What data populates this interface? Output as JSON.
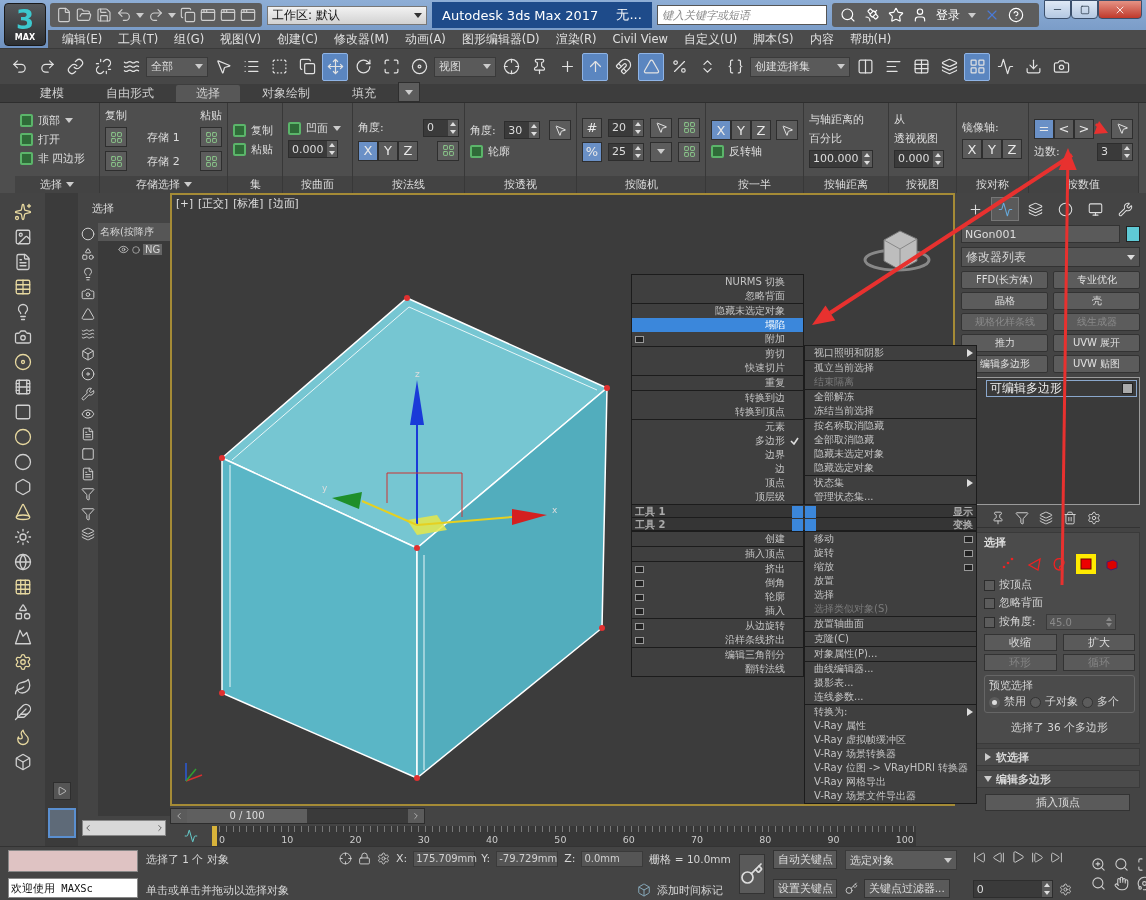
{
  "logo": {
    "digit": "3",
    "sub": "MAX"
  },
  "workspace": "工作区: 默认",
  "title": "Autodesk 3ds Max 2017",
  "file_title": "无...",
  "search": {
    "placeholder": "键入关键字或短语"
  },
  "login": "登录",
  "menu": [
    "编辑(E)",
    "工具(T)",
    "组(G)",
    "视图(V)",
    "创建(C)",
    "修改器(M)",
    "动画(A)",
    "图形编辑器(D)",
    "渲染(R)",
    "Civil View",
    "自定义(U)",
    "脚本(S)",
    "内容",
    "帮助(H)"
  ],
  "toolbar": [
    {
      "kind": "tool",
      "selected": false
    },
    {
      "kind": "tool",
      "selected": false
    },
    {
      "kind": "tool",
      "selected": false
    },
    {
      "kind": "tool",
      "selected": false
    },
    {
      "kind": "tool",
      "selected": false
    },
    {
      "kind": "dropdown",
      "value": "全部"
    },
    {
      "kind": "tool",
      "selected": false
    },
    {
      "kind": "tool",
      "selected": false
    },
    {
      "kind": "tool",
      "selected": false
    },
    {
      "kind": "tool",
      "selected": false
    },
    {
      "kind": "tool",
      "selected": true
    },
    {
      "kind": "tool",
      "selected": false
    },
    {
      "kind": "tool",
      "selected": false
    },
    {
      "kind": "tool",
      "selected": false
    },
    {
      "kind": "dropdown",
      "value": "视图"
    },
    {
      "kind": "tool",
      "selected": false
    },
    {
      "kind": "tool",
      "selected": false
    },
    {
      "kind": "tool",
      "selected": false
    },
    {
      "kind": "tool",
      "selected": true
    },
    {
      "kind": "tool",
      "selected": false
    },
    {
      "kind": "tool",
      "selected": true
    },
    {
      "kind": "tool",
      "selected": false
    },
    {
      "kind": "tool",
      "selected": false
    },
    {
      "kind": "tool",
      "selected": false
    },
    {
      "kind": "dropdown",
      "value": "创建选择集"
    },
    {
      "kind": "tool",
      "selected": false
    },
    {
      "kind": "tool",
      "selected": false
    },
    {
      "kind": "tool",
      "selected": false
    },
    {
      "kind": "tool",
      "selected": false
    },
    {
      "kind": "tool",
      "selected": true
    },
    {
      "kind": "tool",
      "selected": false
    },
    {
      "kind": "tool",
      "selected": false
    },
    {
      "kind": "tool",
      "selected": false
    }
  ],
  "ribbon_tabs": [
    {
      "label": "建模",
      "selected": false
    },
    {
      "label": "自由形式",
      "selected": false
    },
    {
      "label": "选择",
      "selected": true
    },
    {
      "label": "对象绘制",
      "selected": false
    },
    {
      "label": "填充",
      "selected": false
    }
  ],
  "ribbon_groups": [
    {
      "title": "选择",
      "menu": true,
      "rows": [
        [
          {
            "kind": "icon-label",
            "label": "顶部",
            "caret": true
          }
        ],
        [
          {
            "kind": "icon-label",
            "label": "打开",
            "caret": false
          }
        ],
        [
          {
            "kind": "icon-label",
            "label": "非 四边形",
            "caret": false
          }
        ]
      ]
    },
    {
      "title": "存储选择",
      "menu": true,
      "rows": [
        [
          {
            "kind": "label",
            "label": "复制"
          },
          {
            "kind": "label",
            "label": "粘贴"
          }
        ],
        [
          {
            "kind": "button"
          },
          {
            "kind": "label",
            "label": "存储 1"
          },
          {
            "kind": "button"
          }
        ],
        [
          {
            "kind": "button"
          },
          {
            "kind": "label",
            "label": "存储 2"
          },
          {
            "kind": "button"
          }
        ]
      ]
    },
    {
      "title": "集",
      "menu": false,
      "rows": [
        [
          {
            "kind": "icon-label",
            "label": "复制",
            "caret": false
          }
        ],
        [
          {
            "kind": "icon-label",
            "label": "粘贴",
            "caret": false
          }
        ]
      ]
    },
    {
      "title": "按曲面",
      "menu": false,
      "rows": [
        [
          {
            "kind": "icon-label",
            "label": "凹面",
            "caret": true
          }
        ],
        [
          {
            "kind": "spinner",
            "value": "0.000"
          }
        ]
      ]
    },
    {
      "title": "按法线",
      "menu": false,
      "rows": [
        [
          {
            "kind": "label",
            "label": "角度:"
          },
          {
            "kind": "spinner",
            "value": "0"
          }
        ],
        [
          {
            "kind": "axis",
            "axes": [
              {
                "label": "X",
                "selected": true
              },
              {
                "label": "Y",
                "selected": false
              },
              {
                "label": "Z",
                "selected": false
              }
            ]
          },
          {
            "kind": "button"
          }
        ]
      ]
    },
    {
      "title": "按透视",
      "menu": false,
      "rows": [
        [
          {
            "kind": "label",
            "label": "角度:"
          },
          {
            "kind": "spinner",
            "value": "30"
          },
          {
            "kind": "pointer"
          }
        ],
        [
          {
            "kind": "icon-label",
            "label": "轮廓",
            "caret": false
          }
        ]
      ]
    },
    {
      "title": "按随机",
      "menu": false,
      "rows": [
        [
          {
            "kind": "toggle",
            "label": "#",
            "selected": false
          },
          {
            "kind": "spinner",
            "value": "20"
          },
          {
            "kind": "pointer"
          },
          {
            "kind": "button"
          }
        ],
        [
          {
            "kind": "toggle",
            "label": "%",
            "selected": true
          },
          {
            "kind": "spinner",
            "value": "25"
          },
          {
            "kind": "caret-button"
          },
          {
            "kind": "button"
          }
        ]
      ]
    },
    {
      "title": "按一半",
      "menu": false,
      "rows": [
        [
          {
            "kind": "axis",
            "axes": [
              {
                "label": "X",
                "selected": true
              },
              {
                "label": "Y",
                "selected": false
              },
              {
                "label": "Z",
                "selected": false
              }
            ]
          },
          {
            "kind": "pointer"
          }
        ],
        [
          {
            "kind": "icon-label",
            "label": "反转轴",
            "caret": false
          }
        ]
      ]
    },
    {
      "title": "按轴距离",
      "menu": false,
      "rows": [
        [
          {
            "kind": "label",
            "label": "与轴距离的"
          }
        ],
        [
          {
            "kind": "label",
            "label": "百分比"
          }
        ],
        [
          {
            "kind": "spinner",
            "value": "100.000"
          }
        ]
      ]
    },
    {
      "title": "按视图",
      "menu": false,
      "rows": [
        [
          {
            "kind": "label",
            "label": "从"
          }
        ],
        [
          {
            "kind": "label",
            "label": "透视视图"
          }
        ],
        [
          {
            "kind": "spinner",
            "value": "0.000"
          }
        ]
      ]
    },
    {
      "title": "按对称",
      "menu": false,
      "rows": [
        [
          {
            "kind": "label",
            "label": "镜像轴:"
          }
        ],
        [
          {
            "kind": "axis",
            "axes": [
              {
                "label": "X",
                "selected": false
              },
              {
                "label": "Y",
                "selected": false
              },
              {
                "label": "Z",
                "selected": false
              }
            ]
          }
        ]
      ]
    },
    {
      "title": "按数值",
      "menu": false,
      "rows": [
        [
          {
            "kind": "axis",
            "axes": [
              {
                "label": "=",
                "selected": true
              },
              {
                "label": "<",
                "selected": false
              },
              {
                "label": ">",
                "selected": false
              }
            ]
          },
          {
            "kind": "pointer"
          }
        ],
        [
          {
            "kind": "label",
            "label": "边数:"
          },
          {
            "kind": "spinner",
            "value": "3"
          }
        ]
      ]
    }
  ],
  "explorer": {
    "title": "选择",
    "column": "名称(按降序",
    "row": "NG"
  },
  "viewport": {
    "labels": [
      "[+]",
      "[正交]",
      "[标准]",
      "[边面]"
    ],
    "gizmo_labels": [
      "z",
      "y",
      "x"
    ]
  },
  "quad": {
    "top_left": [
      [
        {
          "label": "NURMS 切换",
          "kind": "plain",
          "selected": false
        },
        {
          "label": "忽略背面",
          "kind": "plain",
          "selected": false
        }
      ],
      [
        {
          "label": "隐藏未选定对象",
          "kind": "plain",
          "selected": false
        },
        {
          "label": "塌陷",
          "kind": "plain",
          "selected": true
        },
        {
          "label": "附加",
          "kind": "box",
          "selected": false
        }
      ],
      [
        {
          "label": "剪切",
          "kind": "plain",
          "selected": false
        },
        {
          "label": "快速切片",
          "kind": "plain",
          "selected": false
        }
      ],
      [
        {
          "label": "重复",
          "kind": "plain",
          "selected": false
        }
      ],
      [
        {
          "label": "转换到边",
          "kind": "plain",
          "selected": false
        },
        {
          "label": "转换到顶点",
          "kind": "plain",
          "selected": false
        }
      ],
      [
        {
          "label": "元素",
          "kind": "plain",
          "selected": false,
          "checked": false
        },
        {
          "label": "多边形",
          "kind": "plain",
          "selected": false,
          "checked": true
        },
        {
          "label": "边界",
          "kind": "plain",
          "selected": false,
          "checked": false
        },
        {
          "label": "边",
          "kind": "plain",
          "selected": false,
          "checked": false
        },
        {
          "label": "顶点",
          "kind": "plain",
          "selected": false,
          "checked": false
        },
        {
          "label": "顶层级",
          "kind": "plain",
          "selected": false,
          "checked": false
        }
      ]
    ],
    "top_right": [
      [
        {
          "label": "视口照明和阴影",
          "kind": "submenu",
          "selected": false
        }
      ],
      [
        {
          "label": "孤立当前选择",
          "kind": "plain",
          "selected": false,
          "disabled": false
        },
        {
          "label": "结束隔离",
          "kind": "plain",
          "selected": false,
          "disabled": true
        }
      ],
      [
        {
          "label": "全部解冻",
          "kind": "plain",
          "selected": false
        },
        {
          "label": "冻结当前选择",
          "kind": "plain",
          "selected": false
        }
      ],
      [
        {
          "label": "按名称取消隐藏",
          "kind": "plain",
          "selected": false
        },
        {
          "label": "全部取消隐藏",
          "kind": "plain",
          "selected": false
        },
        {
          "label": "隐藏未选定对象",
          "kind": "plain",
          "selected": false
        },
        {
          "label": "隐藏选定对象",
          "kind": "plain",
          "selected": false
        }
      ],
      [
        {
          "label": "状态集",
          "kind": "submenu",
          "selected": false
        },
        {
          "label": "管理状态集...",
          "kind": "plain",
          "selected": false
        }
      ]
    ],
    "bars": [
      {
        "left": "工具 1",
        "right": "显示"
      },
      {
        "left": "工具 2",
        "right": "变换"
      }
    ],
    "bottom_left": [
      [
        {
          "label": "创建",
          "kind": "plain",
          "selected": false
        }
      ],
      [
        {
          "label": "插入顶点",
          "kind": "plain",
          "selected": false
        }
      ],
      [
        {
          "label": "挤出",
          "kind": "box",
          "selected": false
        },
        {
          "label": "倒角",
          "kind": "box",
          "selected": false
        },
        {
          "label": "轮廓",
          "kind": "box",
          "selected": false
        },
        {
          "label": "插入",
          "kind": "box",
          "selected": false
        }
      ],
      [
        {
          "label": "从边旋转",
          "kind": "box",
          "selected": false
        },
        {
          "label": "沿样条线挤出",
          "kind": "box",
          "selected": false
        }
      ],
      [
        {
          "label": "编辑三角剖分",
          "kind": "plain",
          "selected": false
        },
        {
          "label": "翻转法线",
          "kind": "plain",
          "selected": false
        }
      ]
    ],
    "bottom_right": [
      [
        {
          "label": "移动",
          "kind": "box",
          "selected": false,
          "disabled": false
        },
        {
          "label": "旋转",
          "kind": "box",
          "selected": false,
          "disabled": false
        },
        {
          "label": "缩放",
          "kind": "box",
          "selected": false,
          "disabled": false
        },
        {
          "label": "放置",
          "kind": "plain",
          "selected": false,
          "disabled": false
        },
        {
          "label": "选择",
          "kind": "plain",
          "selected": false,
          "disabled": false
        },
        {
          "label": "选择类似对象(S)",
          "kind": "plain",
          "selected": false,
          "disabled": true
        }
      ],
      [
        {
          "label": "放置轴曲面",
          "kind": "plain",
          "selected": false
        }
      ],
      [
        {
          "label": "克隆(C)",
          "kind": "plain",
          "selected": false
        }
      ],
      [
        {
          "label": "对象属性(P)...",
          "kind": "plain",
          "selected": false
        }
      ],
      [
        {
          "label": "曲线编辑器...",
          "kind": "plain",
          "selected": false
        },
        {
          "label": "摄影表...",
          "kind": "plain",
          "selected": false
        },
        {
          "label": "连线参数...",
          "kind": "plain",
          "selected": false
        }
      ],
      [
        {
          "label": "转换为:",
          "kind": "submenu",
          "selected": false
        },
        {
          "label": "V-Ray 属性",
          "kind": "plain",
          "selected": false
        },
        {
          "label": "V-Ray 虚拟帧缓冲区",
          "kind": "plain",
          "selected": false
        },
        {
          "label": "V-Ray 场景转换器",
          "kind": "plain",
          "selected": false
        },
        {
          "label": "V-Ray 位图 -> VRayHDRI 转换器",
          "kind": "plain",
          "selected": false
        },
        {
          "label": "V-Ray 网格导出",
          "kind": "plain",
          "selected": false
        },
        {
          "label": "V-Ray 场景文件导出器",
          "kind": "plain",
          "selected": false
        }
      ]
    ]
  },
  "command_panel": {
    "tabs": [
      {
        "selected": false
      },
      {
        "selected": true
      },
      {
        "selected": false
      },
      {
        "selected": false
      },
      {
        "selected": false
      },
      {
        "selected": false
      }
    ],
    "object_name": "NGon001",
    "modifier_list": "修改器列表",
    "modifier_buttons": [
      {
        "label": "FFD(长方体)",
        "disabled": false
      },
      {
        "label": "专业优化",
        "disabled": false
      },
      {
        "label": "晶格",
        "disabled": false
      },
      {
        "label": "壳",
        "disabled": false
      },
      {
        "label": "规格化样条线",
        "disabled": true
      },
      {
        "label": "线生成器",
        "disabled": true
      },
      {
        "label": "推力",
        "disabled": false
      },
      {
        "label": "UVW 展开",
        "disabled": false
      },
      {
        "label": "编辑多边形",
        "disabled": false
      },
      {
        "label": "UVW 贴图",
        "disabled": false
      }
    ],
    "stack": [
      "可编辑多边形"
    ],
    "selection": {
      "title": "选择",
      "subobjects": [
        {
          "selected": false
        },
        {
          "selected": false
        },
        {
          "selected": false
        },
        {
          "selected": true
        },
        {
          "selected": false
        }
      ],
      "checkboxes": [
        {
          "label": "按顶点",
          "checked": false
        },
        {
          "label": "忽略背面",
          "checked": false
        },
        {
          "label": "按角度:",
          "checked": false
        }
      ],
      "angle": "45.0",
      "buttons": [
        {
          "label": "收缩",
          "disabled": false
        },
        {
          "label": "扩大",
          "disabled": false
        },
        {
          "label": "环形",
          "disabled": true
        },
        {
          "label": "循环",
          "disabled": true
        }
      ],
      "preview_title": "预览选择",
      "preview": [
        {
          "label": "禁用",
          "selected": true
        },
        {
          "label": "子对象",
          "selected": false
        },
        {
          "label": "多个",
          "selected": false
        }
      ],
      "info": "选择了 36 个多边形"
    },
    "rollouts": [
      {
        "title": "软选择",
        "expanded": false
      },
      {
        "title": "编辑多边形",
        "expanded": true,
        "button": "插入顶点"
      }
    ]
  },
  "timeline": {
    "frame": "0 / 100",
    "ticks": [
      "0",
      "10",
      "20",
      "30",
      "40",
      "50",
      "60",
      "70",
      "80",
      "90",
      "100"
    ]
  },
  "status": {
    "welcome": "欢迎使用 MAXSc",
    "selected": "选择了 1 个 对象",
    "prompt": "单击或单击并拖动以选择对象",
    "coords": [
      {
        "axis": "X:",
        "value": "175.709mm"
      },
      {
        "axis": "Y:",
        "value": "-79.729mm"
      },
      {
        "axis": "Z:",
        "value": "0.0mm"
      }
    ],
    "grid": "栅格 = 10.0mm",
    "time_tag": "添加时间标记",
    "auto_key": "自动关键点",
    "set_key": "设置关键点",
    "key_mode": "选定对象",
    "key_filters": "关键点过滤器...",
    "frame": "0"
  }
}
